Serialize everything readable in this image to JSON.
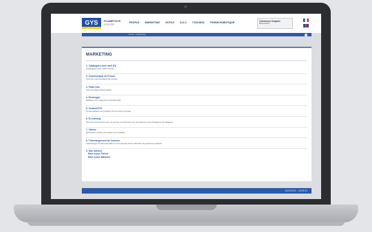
{
  "header": {
    "logo": "GYS",
    "brand_title": "PLANETGYS",
    "brand_sub": "GYS-FR",
    "nav": [
      "PEOPLE",
      "MARKETING",
      "OUTILS",
      "S.A.V.",
      "TOOLBOX",
      "FORUM ROBOTIQUE"
    ],
    "user_name": "Clemence Dupont",
    "user_sub": "Déconnexion"
  },
  "breadcrumb": "Home > Marketing",
  "help_label": "?",
  "page": {
    "title": "MARKETING",
    "items": [
      {
        "title": "1. Catalogues avec tarif (FI)",
        "desc": "Catalogues avec tarifs France"
      },
      {
        "title": "2. Communiqué de Presse",
        "desc": "Tous les communiqués de presse"
      },
      {
        "title": "3. Flash Info",
        "desc": "Tous les flash d'information"
      },
      {
        "title": "4. Promogys",
        "desc": "Réalisez vos supports promotionnels"
      },
      {
        "title": "5. CustomGYS",
        "desc": "Personnalisez les produits GYS à votre marque"
      },
      {
        "title": "6. E-Learning",
        "desc": "Tous les documents pour se former et s'informer sur la soudure et les chargeurs de batteries"
      },
      {
        "title": "7. Vidéos",
        "desc": "Découvrez toutes nos vidéos sur Youtube"
      },
      {
        "title": "8. Téléchargement de Contenu",
        "desc": "Téléchargez la documentation et les photos d'une sélection de gammes produits"
      }
    ],
    "last_item": {
      "title": "9. Site Internet",
      "subs": [
        "Mise à jour Fiches",
        "Mise à jour Manuels"
      ]
    }
  },
  "footer_date": "11/01/2021 - 15:05:24"
}
